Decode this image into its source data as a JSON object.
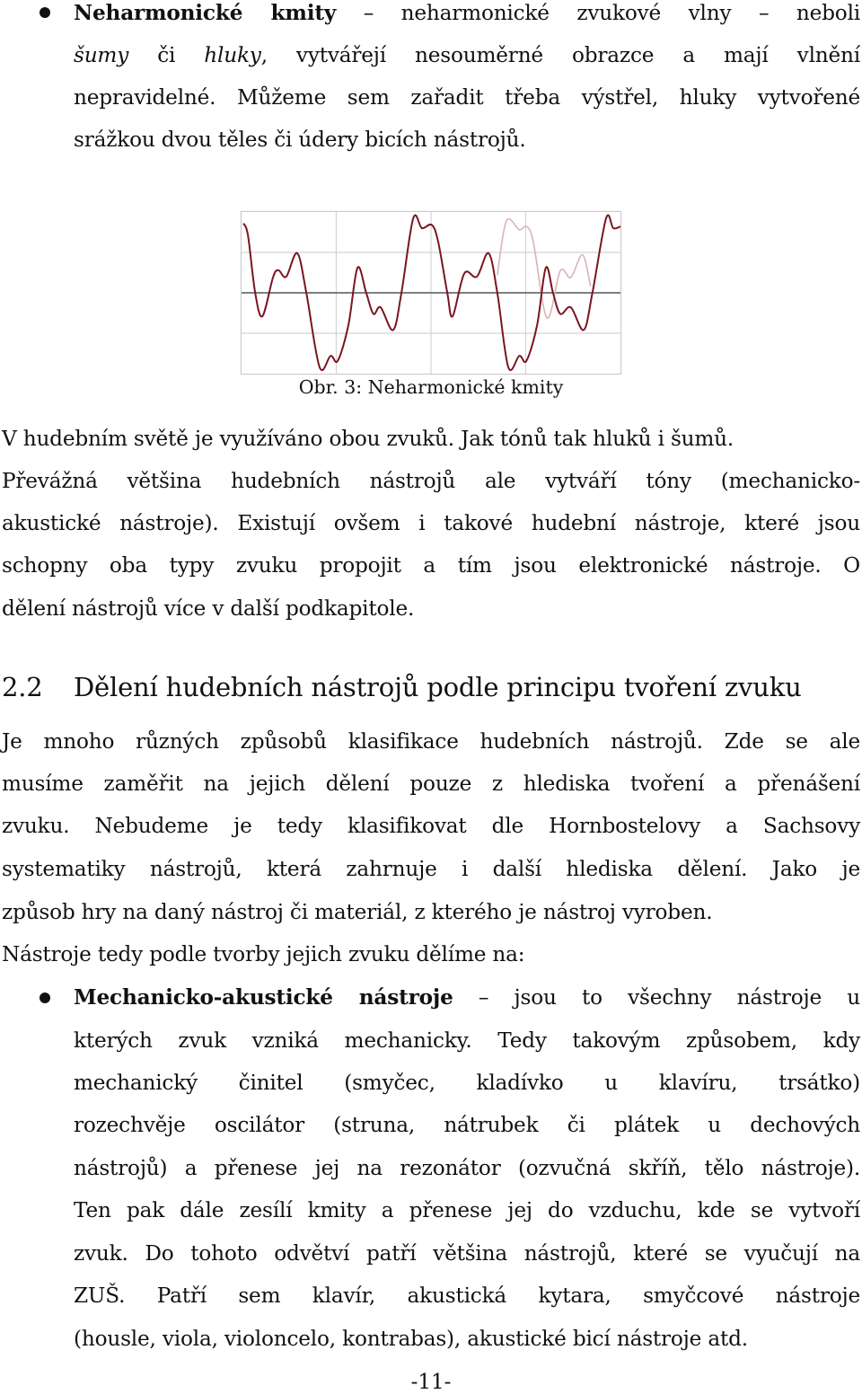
{
  "bullet1": {
    "term": "Neharmonické kmity",
    "lines": [
      [
        {
          "t": "Neharmonické kmity",
          "s": "b"
        },
        {
          "t": " – neharmonické zvukové vlny – neboli",
          "s": ""
        }
      ],
      [
        {
          "t": "šumy",
          "s": "i"
        },
        {
          "t": " či ",
          "s": ""
        },
        {
          "t": "hluky",
          "s": "i"
        },
        {
          "t": ", vytvářejí nesouměrné obrazce a mají vlnění",
          "s": ""
        }
      ],
      [
        {
          "t": "nepravidelné. Můžeme sem zařadit třeba výstřel, hluky vytvořené",
          "s": ""
        }
      ],
      [
        {
          "t": "srážkou dvou těles či údery bicích nástrojů.",
          "s": ""
        }
      ]
    ]
  },
  "figure": {
    "caption": "Obr. 3: Neharmonické kmity",
    "colors": {
      "main": "#7a1520",
      "faint": "#d9b3b6",
      "zero_line": "#555555",
      "grid": "#d4d4d4"
    }
  },
  "chart_data": {
    "type": "line",
    "title": "Obr. 3: Neharmonické kmity",
    "xlabel": "",
    "ylabel": "",
    "xlim": [
      0,
      1
    ],
    "ylim": [
      -1,
      1
    ],
    "grid": true,
    "x_gridlines": [
      0.25,
      0.5,
      0.75
    ],
    "y_gridlines": [
      -0.5,
      0,
      0.5
    ],
    "series": [
      {
        "name": "waveform",
        "x": [
          0.005,
          0.017,
          0.036,
          0.055,
          0.083,
          0.097,
          0.118,
          0.147,
          0.171,
          0.206,
          0.235,
          0.254,
          0.282,
          0.306,
          0.329,
          0.348,
          0.367,
          0.4,
          0.422,
          0.453,
          0.476,
          0.502,
          0.519,
          0.543,
          0.557,
          0.588,
          0.621,
          0.652,
          0.675,
          0.704,
          0.733,
          0.752,
          0.78,
          0.803,
          0.822,
          0.841,
          0.869,
          0.903,
          0.926,
          0.962,
          0.981,
          1.0
        ],
        "y": [
          0.86,
          0.71,
          0,
          -0.29,
          0.19,
          0.28,
          0.2,
          0.49,
          0,
          -0.92,
          -0.78,
          -0.84,
          -0.4,
          0.31,
          0,
          -0.26,
          -0.18,
          -0.46,
          0,
          0.92,
          0.8,
          0.84,
          0.63,
          0,
          -0.29,
          0.24,
          0.2,
          0.49,
          0,
          -0.92,
          -0.78,
          -0.84,
          -0.4,
          0.31,
          0,
          -0.26,
          -0.18,
          -0.46,
          0,
          0.92,
          0.8,
          0.82
        ]
      },
      {
        "name": "waveform-shifted-faint",
        "x": [
          0.675,
          0.699,
          0.733,
          0.752,
          0.77,
          0.806,
          0.841,
          0.869,
          0.9,
          0.921
        ],
        "y": [
          0.22,
          0.89,
          0.78,
          0.82,
          0.63,
          -0.31,
          0.27,
          0.19,
          0.47,
          0.08
        ]
      }
    ]
  },
  "para1": {
    "lines": [
      "V hudebním světě je využíváno obou zvuků. Jak tónů tak hluků i šumů.",
      "Převážná většina hudebních nástrojů ale vytváří tóny (mechanicko-",
      "akustické nástroje). Existují ovšem i takové hudební nástroje, které jsou",
      "schopny oba typy zvuku propojit a tím jsou elektronické nástroje. O",
      "dělení nástrojů více v další podkapitole."
    ]
  },
  "section": {
    "number": "2.2",
    "title": "Dělení hudebních nástrojů podle principu tvoření zvuku"
  },
  "para2": {
    "lines": [
      "Je mnoho různých způsobů klasifikace hudebních nástrojů. Zde se ale",
      "musíme zaměřit na jejich dělení pouze z hlediska tvoření a přenášení",
      "zvuku. Nebudeme je tedy klasifikovat dle Hornbostelovy a Sachsovy",
      "systematiky nástrojů, která zahrnuje i další hlediska dělení. Jako je",
      "způsob hry na daný nástroj či materiál, z kterého je nástroj vyroben.",
      "Nástroje tedy podle tvorby jejich zvuku dělíme na:"
    ]
  },
  "bullet2": {
    "lines": [
      [
        {
          "t": "Mechanicko-akustické nástroje",
          "s": "b"
        },
        {
          "t": " – jsou to všechny nástroje u",
          "s": ""
        }
      ],
      [
        {
          "t": "kterých zvuk vzniká mechanicky. Tedy takovým způsobem, kdy",
          "s": ""
        }
      ],
      [
        {
          "t": "mechanický činitel (smyčec, kladívko u klavíru, trsátko)",
          "s": ""
        }
      ],
      [
        {
          "t": "rozechvěje oscilátor (struna, nátrubek či plátek u dechových",
          "s": ""
        }
      ],
      [
        {
          "t": "nástrojů) a přenese jej na rezonátor (ozvučná skříň, tělo nástroje).",
          "s": ""
        }
      ],
      [
        {
          "t": "Ten pak dále zesílí kmity a přenese jej do vzduchu, kde se vytvoří",
          "s": ""
        }
      ],
      [
        {
          "t": "zvuk. Do tohoto odvětví patří většina nástrojů, které se vyučují na",
          "s": ""
        }
      ],
      [
        {
          "t": "ZUŠ. Patří sem klavír, akustická kytara, smyčcové nástroje",
          "s": ""
        }
      ],
      [
        {
          "t": "(housle, viola, violoncelo, kontrabas), akustické bicí nástroje atd.",
          "s": ""
        }
      ]
    ]
  },
  "page_number": "-11-"
}
